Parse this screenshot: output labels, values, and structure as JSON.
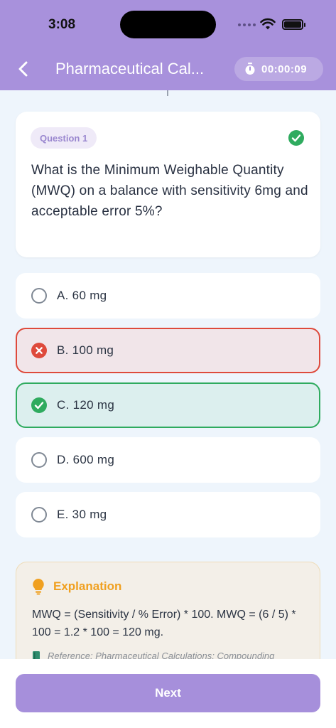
{
  "status_bar": {
    "time": "3:08"
  },
  "header": {
    "title": "Pharmaceutical Cal...",
    "timer": "00:00:09",
    "back_icon": "chevron-left-icon",
    "timer_icon": "stopwatch-icon"
  },
  "question": {
    "badge": "Question 1",
    "text": "What is the Minimum Weighable Quantity (MWQ) on a balance with sensitivity 6mg and acceptable error 5%?",
    "status_icon": "check-circle-icon"
  },
  "options": [
    {
      "label": "A. 60 mg",
      "state": "default"
    },
    {
      "label": "B. 100 mg",
      "state": "wrong"
    },
    {
      "label": "C. 120 mg",
      "state": "correct"
    },
    {
      "label": "D. 600 mg",
      "state": "default"
    },
    {
      "label": "E. 30 mg",
      "state": "default"
    }
  ],
  "explanation": {
    "title": "Explanation",
    "body": "MWQ = (Sensitivity / % Error) * 100. MWQ = (6 / 5) * 100 = 1.2 * 100 = 120 mg.",
    "reference": "Reference: Pharmaceutical Calculations; Compounding",
    "icon": "lightbulb-icon"
  },
  "footer": {
    "next_label": "Next"
  },
  "colors": {
    "header": "#a891dc",
    "correct": "#2fab5f",
    "wrong": "#de4a3c",
    "accent": "#f0a020"
  }
}
